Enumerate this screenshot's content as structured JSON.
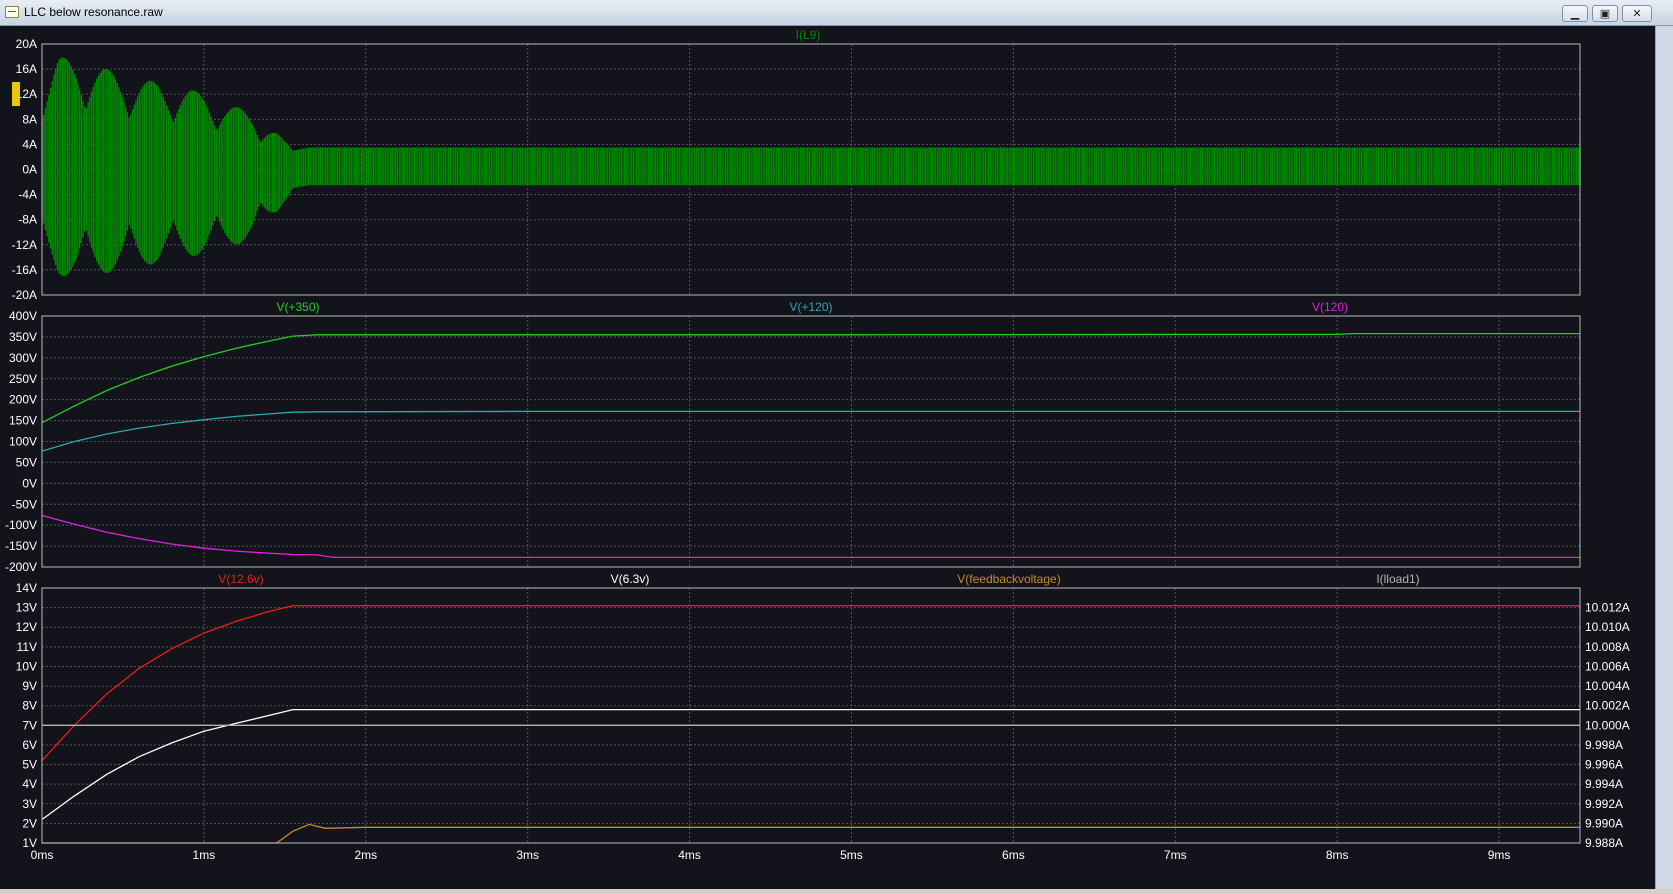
{
  "window": {
    "title": "LLC below resonance.raw",
    "controls": {
      "minimize": "▁",
      "restore": "▣",
      "close": "✕"
    }
  },
  "colors": {
    "background": "#13131b",
    "grid": "#55555f",
    "axis_text": "#ffffff",
    "I(L9)": "#008a00",
    "V(+350)": "#20d020",
    "V(+120)": "#2aa9b0",
    "V(120)": "#e020e0",
    "V(12.6v)": "#ee1c1c",
    "V(6.3v)": "#ffffff",
    "V(feedbackvoltage)": "#c88a2a",
    "I(lload1)": "#b4b4b4"
  },
  "chart_data": [
    {
      "type": "line",
      "pane": "top",
      "title": "",
      "x_label": "",
      "x_ticks": [
        "0ms",
        "1ms",
        "2ms",
        "3ms",
        "4ms",
        "5ms",
        "6ms",
        "7ms",
        "8ms",
        "9ms"
      ],
      "xlim": [
        0,
        9.5
      ],
      "x_units": "ms",
      "ylim": [
        -20,
        20
      ],
      "y_ticks": [
        "20A",
        "16A",
        "12A",
        "8A",
        "4A",
        "0A",
        "-4A",
        "-8A",
        "-12A",
        "-16A",
        "-20A"
      ],
      "grid": true,
      "legend": [
        "I(L9)"
      ],
      "series": [
        {
          "name": "I(L9)",
          "style": "high-frequency oscillation (envelope shown)",
          "x": [
            0.0,
            0.1,
            0.3,
            0.5,
            0.7,
            0.9,
            1.1,
            1.3,
            1.45,
            1.55,
            1.65,
            2.0,
            3.0,
            4.0,
            5.0,
            6.0,
            7.0,
            8.0,
            9.0,
            9.5
          ],
          "upper": [
            14,
            18,
            17,
            15,
            14,
            13,
            11,
            9,
            6,
            3,
            3.5,
            3.5,
            3.5,
            3.5,
            3.5,
            3.5,
            3.5,
            3.5,
            3.5,
            3.5
          ],
          "lower": [
            -14,
            -17,
            -17,
            -16,
            -15,
            -14,
            -13,
            -11,
            -7,
            -3,
            -2.5,
            -2.5,
            -2.5,
            -2.5,
            -2.5,
            -2.5,
            -2.5,
            -2.5,
            -2.5,
            -2.5
          ]
        }
      ]
    },
    {
      "type": "line",
      "pane": "middle",
      "title": "",
      "x_label": "",
      "x_ticks": [
        "0ms",
        "1ms",
        "2ms",
        "3ms",
        "4ms",
        "5ms",
        "6ms",
        "7ms",
        "8ms",
        "9ms"
      ],
      "xlim": [
        0,
        9.5
      ],
      "x_units": "ms",
      "ylim": [
        -200,
        400
      ],
      "y_ticks": [
        "400V",
        "350V",
        "300V",
        "250V",
        "200V",
        "150V",
        "100V",
        "50V",
        "0V",
        "-50V",
        "-100V",
        "-150V",
        "-200V"
      ],
      "grid": true,
      "legend": [
        "V(+350)",
        "V(+120)",
        "V(120)"
      ],
      "series": [
        {
          "name": "V(+350)",
          "x": [
            0,
            0.2,
            0.4,
            0.6,
            0.8,
            1.0,
            1.2,
            1.4,
            1.55,
            1.7,
            3,
            5,
            7,
            8,
            8.1,
            9.5
          ],
          "y": [
            145,
            185,
            222,
            253,
            280,
            303,
            323,
            340,
            352,
            355,
            355,
            355,
            356,
            356,
            358,
            358
          ]
        },
        {
          "name": "V(+120)",
          "x": [
            0,
            0.2,
            0.4,
            0.6,
            0.8,
            1.0,
            1.2,
            1.4,
            1.55,
            1.7,
            3,
            5,
            7,
            9.5
          ],
          "y": [
            77,
            100,
            118,
            132,
            143,
            152,
            160,
            166,
            170,
            171,
            172,
            172,
            172,
            172
          ]
        },
        {
          "name": "V(120)",
          "x": [
            0,
            0.2,
            0.4,
            0.6,
            0.8,
            1.0,
            1.2,
            1.4,
            1.55,
            1.7,
            1.8,
            3,
            5,
            7,
            9.5
          ],
          "y": [
            -77,
            -98,
            -117,
            -132,
            -145,
            -155,
            -162,
            -167,
            -170,
            -171,
            -177,
            -177,
            -177,
            -177,
            -177
          ]
        }
      ]
    },
    {
      "type": "line",
      "pane": "bottom",
      "title": "",
      "x_label": "",
      "x_ticks": [
        "0ms",
        "1ms",
        "2ms",
        "3ms",
        "4ms",
        "5ms",
        "6ms",
        "7ms",
        "8ms",
        "9ms"
      ],
      "xlim": [
        0,
        9.5
      ],
      "x_units": "ms",
      "ylim": [
        1,
        14
      ],
      "y_ticks": [
        "14V",
        "13V",
        "12V",
        "11V",
        "10V",
        "9V",
        "8V",
        "7V",
        "6V",
        "5V",
        "4V",
        "3V",
        "2V",
        "1V"
      ],
      "y2lim": [
        9.988,
        10.014
      ],
      "y2_ticks": [
        "10.012A",
        "10.010A",
        "10.008A",
        "10.006A",
        "10.004A",
        "10.002A",
        "10.000A",
        "9.998A",
        "9.996A",
        "9.994A",
        "9.992A",
        "9.990A",
        "9.988A"
      ],
      "grid": true,
      "legend": [
        "V(12.6v)",
        "V(6.3v)",
        "V(feedbackvoltage)",
        "I(lload1)"
      ],
      "series": [
        {
          "name": "V(12.6v)",
          "x": [
            0,
            0.2,
            0.4,
            0.6,
            0.8,
            1.0,
            1.2,
            1.4,
            1.55,
            1.7,
            3,
            5,
            7,
            9.5
          ],
          "y": [
            5.2,
            7.0,
            8.6,
            9.9,
            10.9,
            11.7,
            12.3,
            12.8,
            13.1,
            13.1,
            13.1,
            13.1,
            13.1,
            13.1
          ]
        },
        {
          "name": "V(6.3v)",
          "x": [
            0,
            0.2,
            0.4,
            0.6,
            0.8,
            1.0,
            1.2,
            1.4,
            1.55,
            1.7,
            3,
            5,
            7,
            9.5
          ],
          "y": [
            2.2,
            3.4,
            4.5,
            5.4,
            6.1,
            6.7,
            7.1,
            7.5,
            7.8,
            7.8,
            7.8,
            7.8,
            7.8,
            7.8
          ]
        },
        {
          "name": "V(feedbackvoltage)",
          "x": [
            0,
            1.45,
            1.55,
            1.65,
            1.75,
            2.0,
            3,
            5,
            7,
            9.5
          ],
          "y": [
            1.0,
            1.0,
            1.6,
            1.95,
            1.75,
            1.8,
            1.8,
            1.8,
            1.8,
            1.8
          ]
        },
        {
          "name": "I(lload1)",
          "axis": "right",
          "x": [
            0,
            9.5
          ],
          "y": [
            10.0,
            10.0
          ]
        }
      ]
    }
  ]
}
